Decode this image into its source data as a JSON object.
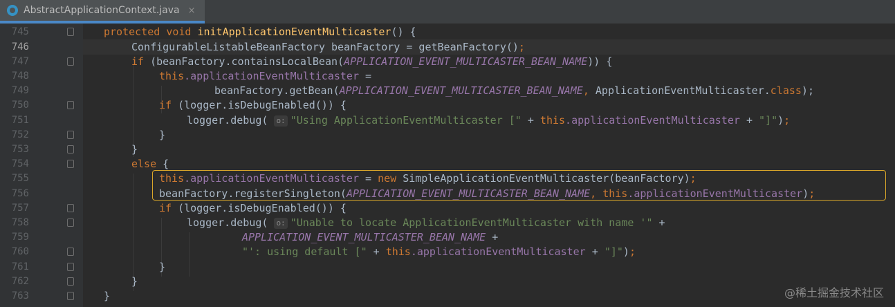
{
  "tab": {
    "filename": "AbstractApplicationContext.java",
    "close": "×"
  },
  "watermark": "@稀土掘金技术社区",
  "lines": [
    {
      "num": "745"
    },
    {
      "num": "746"
    },
    {
      "num": "747"
    },
    {
      "num": "748"
    },
    {
      "num": "749"
    },
    {
      "num": "750"
    },
    {
      "num": "751"
    },
    {
      "num": "752"
    },
    {
      "num": "753"
    },
    {
      "num": "754"
    },
    {
      "num": "755"
    },
    {
      "num": "756"
    },
    {
      "num": "757"
    },
    {
      "num": "758"
    },
    {
      "num": "759"
    },
    {
      "num": "760"
    },
    {
      "num": "761"
    },
    {
      "num": "762"
    },
    {
      "num": "763"
    }
  ],
  "code": {
    "l745_kw1": "protected",
    "l745_kw2": "void",
    "l745_fn": "initApplicationEventMulticaster",
    "l745_rest": "() {",
    "l746_text": "ConfigurableListableBeanFactory beanFactory = getBeanFactory()",
    "l746_semi": ";",
    "l747_kw": "if",
    "l747_a": " (beanFactory.containsLocalBean(",
    "l747_const": "APPLICATION_EVENT_MULTICASTER_BEAN_NAME",
    "l747_b": ")) {",
    "l748_kw": "this",
    "l748_field": ".applicationEventMulticaster",
    "l748_rest": " =",
    "l749_a": "beanFactory.getBean(",
    "l749_const": "APPLICATION_EVENT_MULTICASTER_BEAN_NAME",
    "l749_comma": ",",
    "l749_b": " ApplicationEventMulticaster.",
    "l749_kw": "class",
    "l749_c": ");",
    "l750_kw": "if",
    "l750_rest": " (logger.isDebugEnabled()) {",
    "l751_a": "logger.debug(",
    "l751_hint": "o:",
    "l751_str": "\"Using ApplicationEventMulticaster [\"",
    "l751_b": " + ",
    "l751_kw": "this",
    "l751_field": ".applicationEventMulticaster",
    "l751_c": " + ",
    "l751_str2": "\"]\"",
    "l751_d": ")",
    "l751_semi": ";",
    "l752": "}",
    "l753": "}",
    "l754_kw": "else",
    "l754_rest": " {",
    "l755_kw": "this",
    "l755_field": ".applicationEventMulticaster",
    "l755_a": " = ",
    "l755_kw2": "new",
    "l755_b": " SimpleApplicationEventMulticaster(beanFactory)",
    "l755_semi": ";",
    "l756_a": "beanFactory.registerSingleton(",
    "l756_const": "APPLICATION_EVENT_MULTICASTER_BEAN_NAME",
    "l756_comma": ", ",
    "l756_kw": "this",
    "l756_field": ".applicationEventMulticaster",
    "l756_b": ")",
    "l756_semi": ";",
    "l757_kw": "if",
    "l757_rest": " (logger.isDebugEnabled()) {",
    "l758_a": "logger.debug(",
    "l758_hint": "o:",
    "l758_str": "\"Unable to locate ApplicationEventMulticaster with name '\"",
    "l758_b": " +",
    "l759_const": "APPLICATION_EVENT_MULTICASTER_BEAN_NAME",
    "l759_b": " +",
    "l760_str": "\"': using default [\"",
    "l760_b": " + ",
    "l760_kw": "this",
    "l760_field": ".applicationEventMulticaster",
    "l760_c": " + ",
    "l760_str2": "\"]\"",
    "l760_d": ")",
    "l760_semi": ";",
    "l761": "}",
    "l762": "}",
    "l763": "}"
  }
}
